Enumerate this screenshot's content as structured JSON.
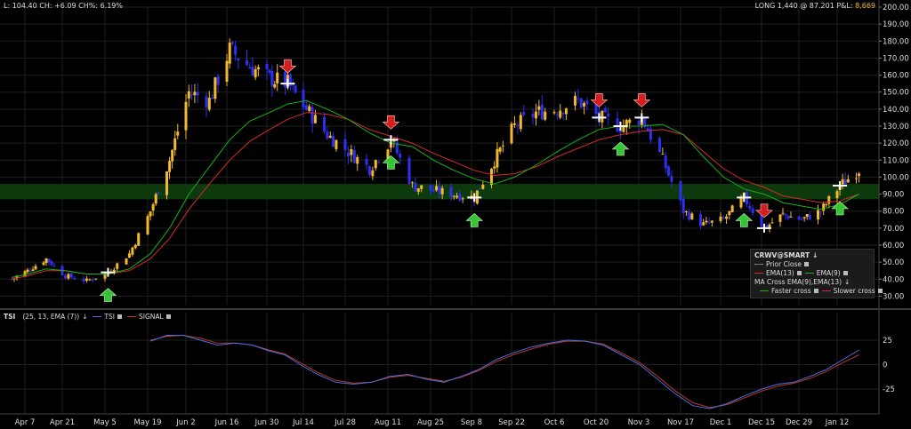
{
  "header": {
    "left": "L: 104.40 CH: +6.09 CH%: 6.19%",
    "right_prefix": "LONG 1,440 @ 87.201 P&L: ",
    "right_pnl": "8,669"
  },
  "legend": {
    "title": "CRWV@SMART",
    "prior_close": "Prior Close",
    "ema13": "EMA(13)",
    "ema9": "EMA(9)",
    "ma_cross": "MA Cross EMA(9),EMA(13)",
    "faster": "Faster cross",
    "slower": "Slower cross"
  },
  "tsi_header": {
    "name": "TSI",
    "params": "(25, 13, EMA (7))",
    "tsi": "TSI",
    "signal": "SIGNAL"
  },
  "colors": {
    "up_candle": "#f2b92c",
    "down_candle": "#2f2ff0",
    "ema13": "#d42a2a",
    "ema9": "#18b018",
    "tsi": "#4a6fe0",
    "signal": "#b8362a",
    "band": "#0d3a0d",
    "sell_arrow": "#d41f1f",
    "buy_arrow": "#35c435"
  },
  "chart_data": [
    {
      "type": "candlestick",
      "title": "",
      "xlabel": "",
      "ylabel": "",
      "ylim": [
        25,
        200
      ],
      "y_ticks": [
        "200.00",
        "190.00",
        "180.00",
        "170.00",
        "160.00",
        "150.00",
        "140.00",
        "130.00",
        "120.00",
        "110.00",
        "100.00",
        "90.00",
        "80.00",
        "70.00",
        "60.00",
        "50.00",
        "40.00",
        "30.00"
      ],
      "x_ticks": [
        "Apr 7",
        "Apr 21",
        "May 5",
        "May 19",
        "Jun 2",
        "Jun 16",
        "Jun 30",
        "Jul 14",
        "Jul 28",
        "Aug 11",
        "Aug 25",
        "Sep 8",
        "Sep 22",
        "Oct 6",
        "Oct 20",
        "Nov 3",
        "Nov 17",
        "Dec 1",
        "Dec 15",
        "Dec 29",
        "Jan 12"
      ],
      "support_band": [
        87,
        96
      ],
      "close_series": [
        {
          "date": "Apr 1",
          "close": 40
        },
        {
          "date": "Apr 7",
          "close": 45
        },
        {
          "date": "Apr 14",
          "close": 52
        },
        {
          "date": "Apr 21",
          "close": 42
        },
        {
          "date": "Apr 28",
          "close": 39
        },
        {
          "date": "May 5",
          "close": 44
        },
        {
          "date": "May 12",
          "close": 55
        },
        {
          "date": "May 19",
          "close": 80
        },
        {
          "date": "May 26",
          "close": 110
        },
        {
          "date": "Jun 2",
          "close": 150
        },
        {
          "date": "Jun 9",
          "close": 145
        },
        {
          "date": "Jun 16",
          "close": 175
        },
        {
          "date": "Jun 23",
          "close": 165
        },
        {
          "date": "Jun 30",
          "close": 158
        },
        {
          "date": "Jul 7",
          "close": 155
        },
        {
          "date": "Jul 14",
          "close": 140
        },
        {
          "date": "Jul 21",
          "close": 125
        },
        {
          "date": "Jul 28",
          "close": 115
        },
        {
          "date": "Aug 4",
          "close": 105
        },
        {
          "date": "Aug 11",
          "close": 122
        },
        {
          "date": "Aug 18",
          "close": 95
        },
        {
          "date": "Aug 25",
          "close": 92
        },
        {
          "date": "Sep 1",
          "close": 90
        },
        {
          "date": "Sep 8",
          "close": 88
        },
        {
          "date": "Sep 15",
          "close": 110
        },
        {
          "date": "Sep 22",
          "close": 130
        },
        {
          "date": "Sep 29",
          "close": 138
        },
        {
          "date": "Oct 6",
          "close": 140
        },
        {
          "date": "Oct 13",
          "close": 145
        },
        {
          "date": "Oct 20",
          "close": 135
        },
        {
          "date": "Oct 27",
          "close": 130
        },
        {
          "date": "Nov 3",
          "close": 135
        },
        {
          "date": "Nov 10",
          "close": 110
        },
        {
          "date": "Nov 17",
          "close": 80
        },
        {
          "date": "Nov 24",
          "close": 72
        },
        {
          "date": "Dec 1",
          "close": 75
        },
        {
          "date": "Dec 8",
          "close": 88
        },
        {
          "date": "Dec 15",
          "close": 70
        },
        {
          "date": "Dec 22",
          "close": 78
        },
        {
          "date": "Dec 29",
          "close": 75
        },
        {
          "date": "Jan 5",
          "close": 80
        },
        {
          "date": "Jan 12",
          "close": 95
        },
        {
          "date": "Jan 19",
          "close": 104.4
        }
      ],
      "ema9": [
        41,
        43,
        46,
        45,
        43,
        43,
        46,
        55,
        70,
        90,
        106,
        122,
        133,
        138,
        143,
        145,
        140,
        134,
        126,
        120,
        118,
        110,
        104,
        99,
        96,
        100,
        107,
        115,
        122,
        128,
        130,
        130,
        131,
        125,
        112,
        100,
        93,
        90,
        85,
        83,
        81,
        84,
        90
      ],
      "ema13": [
        40,
        42,
        45,
        45,
        43,
        43,
        45,
        52,
        64,
        81,
        96,
        110,
        121,
        128,
        134,
        138,
        137,
        134,
        128,
        124,
        120,
        114,
        109,
        104,
        101,
        102,
        106,
        112,
        117,
        122,
        125,
        127,
        128,
        125,
        115,
        105,
        98,
        94,
        89,
        87,
        85,
        86,
        90
      ],
      "markers": [
        {
          "type": "buy",
          "date": "May 5"
        },
        {
          "type": "sell",
          "date": "Jul 7"
        },
        {
          "type": "buy",
          "date": "Aug 11"
        },
        {
          "type": "sell",
          "date": "Aug 11"
        },
        {
          "type": "buy",
          "date": "Sep 8"
        },
        {
          "type": "sell",
          "date": "Oct 20"
        },
        {
          "type": "buy",
          "date": "Oct 27"
        },
        {
          "type": "sell",
          "date": "Nov 3"
        },
        {
          "type": "buy",
          "date": "Dec 8"
        },
        {
          "type": "sell",
          "date": "Dec 15"
        },
        {
          "type": "buy",
          "date": "Jan 12"
        }
      ]
    },
    {
      "type": "line",
      "title": "",
      "ylim": [
        -45,
        40
      ],
      "y_ticks": [
        "25",
        "0",
        "-25"
      ],
      "series": [
        {
          "name": "TSI",
          "values": [
            24,
            30,
            30,
            25,
            20,
            22,
            20,
            14,
            10,
            0,
            -10,
            -18,
            -20,
            -18,
            -12,
            -10,
            -15,
            -18,
            -12,
            -5,
            5,
            12,
            18,
            22,
            25,
            24,
            20,
            10,
            0,
            -15,
            -30,
            -42,
            -45,
            -40,
            -32,
            -25,
            -20,
            -18,
            -12,
            -5,
            5,
            15
          ]
        },
        {
          "name": "SIGNAL",
          "values": [
            25,
            29,
            30,
            27,
            22,
            22,
            20,
            15,
            11,
            2,
            -8,
            -16,
            -19,
            -18,
            -13,
            -11,
            -14,
            -17,
            -13,
            -6,
            3,
            10,
            16,
            21,
            24,
            24,
            21,
            12,
            2,
            -12,
            -27,
            -39,
            -44,
            -41,
            -34,
            -27,
            -22,
            -19,
            -14,
            -7,
            2,
            10
          ]
        }
      ],
      "series_dates_start": "May 19",
      "series_dates_end": "Jan 19"
    }
  ]
}
